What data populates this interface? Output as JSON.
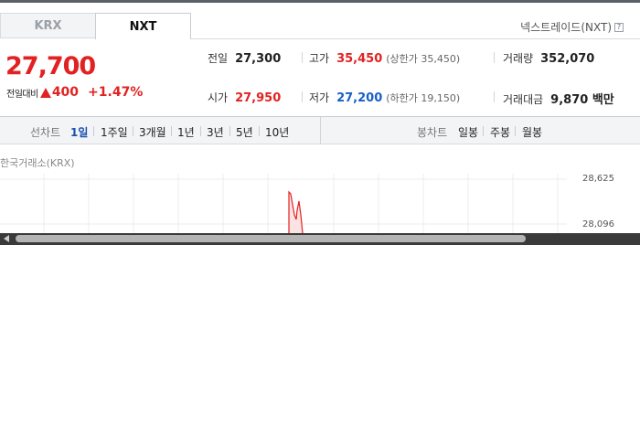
{
  "tabs": [
    {
      "label": "KRX",
      "active": false
    },
    {
      "label": "NXT",
      "active": true
    }
  ],
  "market_link": {
    "label": "넥스트레이드(NXT)",
    "help_icon": "question-icon"
  },
  "price": {
    "current": "27,700",
    "change_label": "전일대비",
    "change_amount": "400",
    "change_percent": "+1.47%",
    "direction_icon": "up-triangle-icon"
  },
  "stats": {
    "prev_close": {
      "label": "전일",
      "value": "27,300"
    },
    "high": {
      "label": "고가",
      "value": "35,450",
      "sub": "(상한가 35,450)"
    },
    "volume": {
      "label": "거래량",
      "value": "352,070"
    },
    "open": {
      "label": "시가",
      "value": "27,950"
    },
    "low": {
      "label": "저가",
      "value": "27,200",
      "sub": "(하한가 19,150)"
    },
    "turnover": {
      "label": "거래대금",
      "value": "9,870 백만"
    }
  },
  "line_chart_bar": {
    "label": "선차트",
    "periods": [
      {
        "label": "1일",
        "active": true
      },
      {
        "label": "1주일",
        "active": false
      },
      {
        "label": "3개월",
        "active": false
      },
      {
        "label": "1년",
        "active": false
      },
      {
        "label": "3년",
        "active": false
      },
      {
        "label": "5년",
        "active": false
      },
      {
        "label": "10년",
        "active": false
      }
    ]
  },
  "candle_chart_bar": {
    "label": "봉차트",
    "periods": [
      {
        "label": "일봉"
      },
      {
        "label": "주봉"
      },
      {
        "label": "월봉"
      }
    ]
  },
  "chart": {
    "source_label": "한국거래소(KRX)",
    "y_ticks": [
      "28,625",
      "28,096"
    ],
    "line_color": "#e22222"
  },
  "colors": {
    "up": "#e22222",
    "down": "#1a5fc7",
    "active_period": "#1a4fb0"
  }
}
